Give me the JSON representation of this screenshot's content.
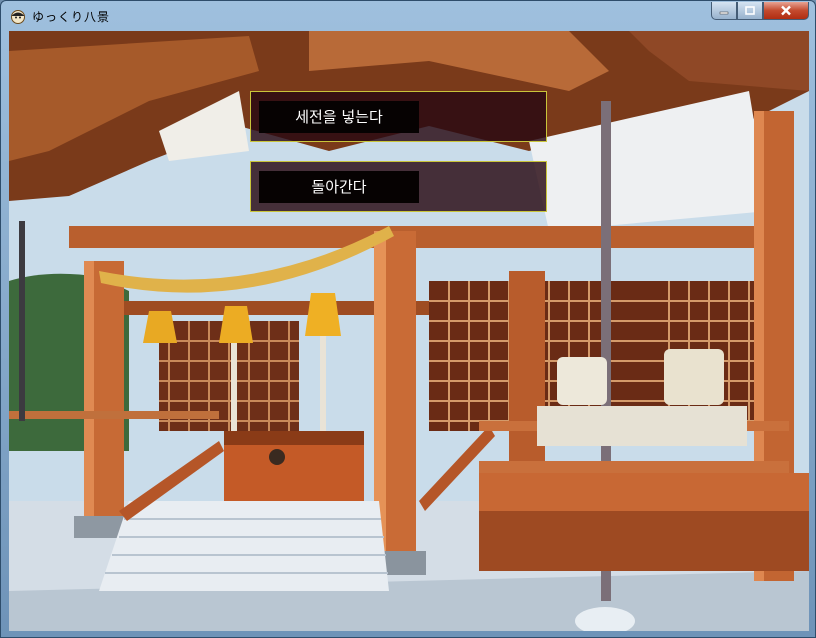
{
  "window": {
    "title": "ゆっくり八景"
  },
  "menu": {
    "choices": [
      {
        "label": "세전을 넣는다"
      },
      {
        "label": "돌아간다"
      }
    ]
  },
  "colors": {
    "choice_border": "#c9c53a",
    "choice_bg": "#28081299",
    "label_bg": "#060202"
  }
}
